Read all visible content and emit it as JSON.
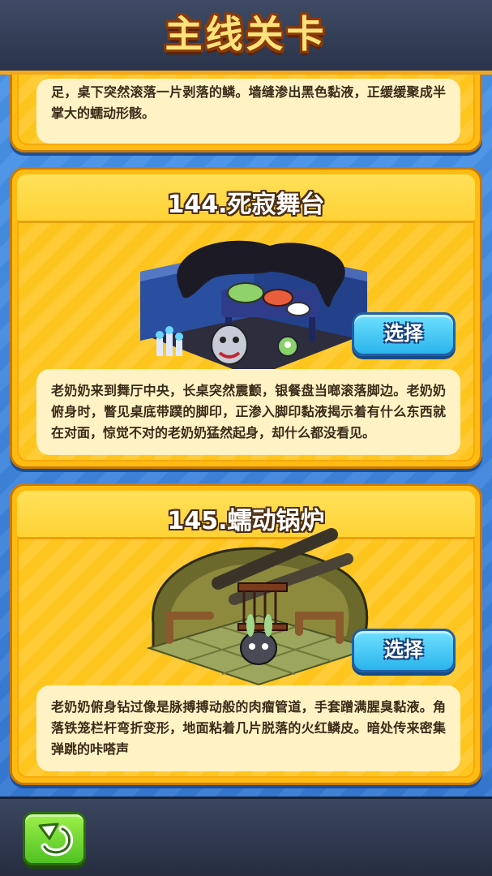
{
  "header": {
    "title": "主线关卡"
  },
  "levels": [
    {
      "partial": true,
      "description": "足，桌下突然滚落一片剥落的鳞。墙缝渗出黑色黏液，正缓缓聚成半掌大的蠕动形骸。"
    },
    {
      "title": "144.死寂舞台",
      "select_label": "选择",
      "description": "老奶奶来到舞厅中央，长桌突然震颤，银餐盘当啷滚落脚边。老奶奶俯身时，瞥见桌底带蹼的脚印，正渗入脚印黏液揭示着有什么东西就在对面，惊觉不对的老奶奶猛然起身，却什么都没看见。"
    },
    {
      "title": "145.蠕动锅炉",
      "select_label": "选择",
      "description": "老奶奶俯身钻过像是脉搏搏动般的肉瘤管道，手套蹭满腥臭黏液。角落铁笼栏杆弯折变形，地面粘着几片脱落的火红鳞皮。暗处传来密集弹跳的咔嗒声"
    }
  ],
  "footer": {
    "back_icon": "return-arrow-icon"
  },
  "colors": {
    "card": "#ffbb12",
    "select_button": "#2bb4ec",
    "back_button": "#4fc223",
    "header": "#2a3349"
  }
}
